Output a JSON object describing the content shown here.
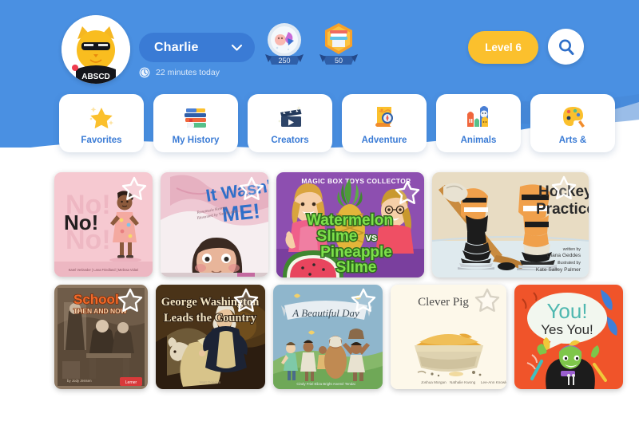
{
  "header": {
    "avatar": {
      "icon": "cat-avatar-icon",
      "shirt_text": "ABSCD"
    },
    "profile": {
      "name": "Charlie",
      "chevron_icon": "chevron-down-icon"
    },
    "reading_time": {
      "icon": "clock-icon",
      "text": "22 minutes today"
    },
    "badges": [
      {
        "icon": "snowglobe-badge-icon",
        "count": "250"
      },
      {
        "icon": "books-badge-icon",
        "count": "50"
      }
    ],
    "level_button": {
      "label": "Level 6"
    },
    "search_button": {
      "icon": "search-icon"
    },
    "colors": {
      "header_blue": "#4a90e2",
      "pill_blue": "#3a7bd5",
      "level_yellow": "#fbc02d",
      "page_white": "#ffffff"
    }
  },
  "categories": [
    {
      "label": "Favorites",
      "icon": "star-sparkle-icon"
    },
    {
      "label": "My History",
      "icon": "book-stack-icon"
    },
    {
      "label": "Creators",
      "icon": "clapperboard-icon"
    },
    {
      "label": "Adventure",
      "icon": "treasure-map-compass-icon"
    },
    {
      "label": "Animals",
      "icon": "animals-group-icon"
    },
    {
      "label": "Arts &",
      "icon": "paint-palette-icon"
    }
  ],
  "books": {
    "row1": [
      {
        "id": "no",
        "title": "No!",
        "credits": "Karel Verlander  |  Lana Friedland  |  Melissa Vidari",
        "cover_bg": "#f6c9d1",
        "favorited": true
      },
      {
        "id": "it-wasnt-me",
        "title_line1": "It Wasn't",
        "title_line2": "ME!",
        "cover_bg": "#f3e3e7",
        "favorited": true
      },
      {
        "id": "watermelon-slime",
        "channel": "MAGIC BOX TOYS COLLECTOR",
        "title_line1": "Watermelon",
        "title_line2": "Slime",
        "title_vs": "vs",
        "title_line3": "Pineapple",
        "title_line4": "Slime",
        "cover_bg": "#8d4fb0",
        "favorited": true
      },
      {
        "id": "hockey-practice",
        "title_line1": "Hockey",
        "title_line2": "Practice",
        "credit_written_label": "written by",
        "credit_written": "Diana Geddes",
        "credit_illus_label": "illustrated by",
        "credit_illus": "Kate Salley Palmer",
        "cover_bg": "#e6d7bb",
        "favorited": true
      }
    ],
    "row2": [
      {
        "id": "school-then-and-now",
        "title_line1": "School",
        "title_line2": "THEN AND NOW",
        "cover_bg": "#6b5647",
        "favorited": true
      },
      {
        "id": "george-washington",
        "title_line1": "George Washington",
        "title_line2": "Leads the Country",
        "cover_bg": "#3d2a18",
        "favorited": true
      },
      {
        "id": "a-beautiful-day",
        "title": "A Beautiful Day",
        "credits": "Cindy Friel        Eliza Bright        Anemé Tendai",
        "cover_bg": "#8fb6cc",
        "favorited": true
      },
      {
        "id": "clever-pig",
        "title": "Clever Pig",
        "credits": "Joshua Morgan      Nathalie Kwong      Lee-Ann Knowles",
        "cover_bg": "#fdf8ea",
        "favorited": true
      },
      {
        "id": "you-yes-you",
        "title_line1": "You!",
        "title_line2": "Yes You!",
        "cover_bg": "#f0542a",
        "favorited": false
      }
    ]
  }
}
